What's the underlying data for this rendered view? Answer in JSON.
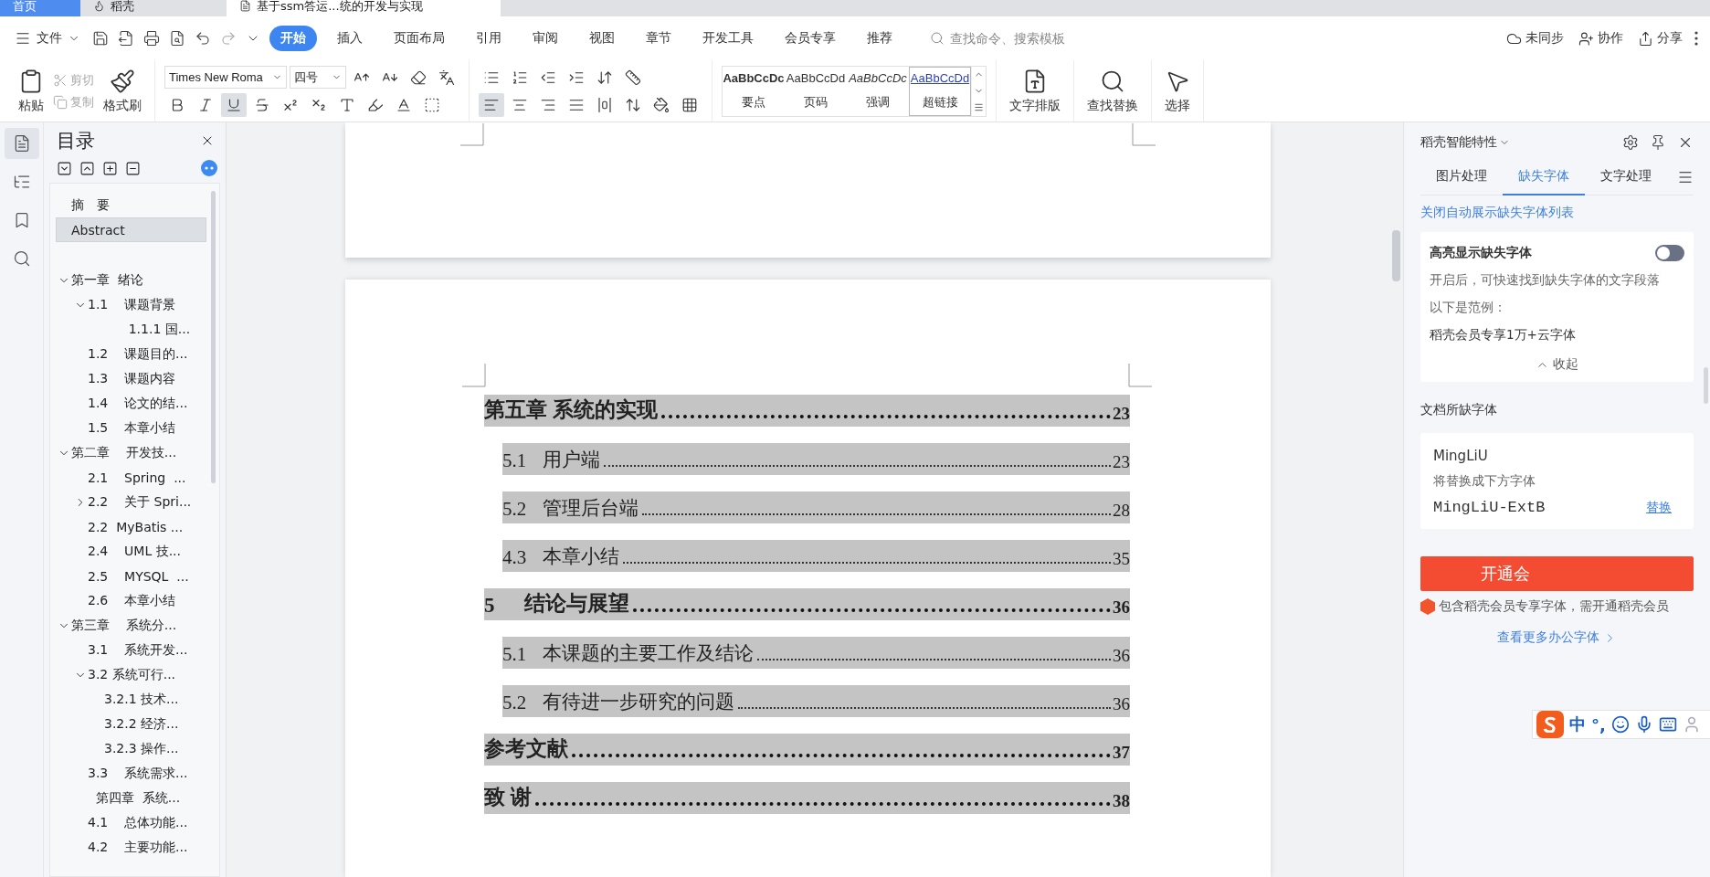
{
  "browser_tabs": [
    {
      "label": "首页",
      "kind": "home",
      "selected": false
    },
    {
      "label": "稻壳",
      "kind": "docer",
      "selected": false
    },
    {
      "label": "基于ssm答运...统的开发与实现",
      "kind": "doc",
      "selected": true
    }
  ],
  "menu": {
    "file": "文件",
    "tabs": [
      {
        "label": "开始",
        "selected": true
      },
      {
        "label": "插入",
        "selected": false
      },
      {
        "label": "页面布局",
        "selected": false
      },
      {
        "label": "引用",
        "selected": false
      },
      {
        "label": "审阅",
        "selected": false
      },
      {
        "label": "视图",
        "selected": false
      },
      {
        "label": "章节",
        "selected": false
      },
      {
        "label": "开发工具",
        "selected": false
      },
      {
        "label": "会员专享",
        "selected": false
      },
      {
        "label": "推荐",
        "selected": false
      }
    ],
    "search": {
      "placeholder": "查找命令、搜索模板"
    },
    "actions": [
      {
        "label": "未同步",
        "kind": "sync"
      },
      {
        "label": "协作",
        "kind": "collab"
      },
      {
        "label": "分享",
        "kind": "share"
      }
    ]
  },
  "ribbon": {
    "clipboard": {
      "paste": "粘贴",
      "format_painter": "格式刷",
      "cut": {
        "label": "剪切",
        "disabled": true
      },
      "copy": {
        "label": "复制",
        "disabled": true
      }
    },
    "font": {
      "name": "Times New Roma",
      "size": "四号",
      "formats": [
        {
          "kind": "bold",
          "selected": false
        },
        {
          "kind": "italic",
          "selected": false
        },
        {
          "kind": "underline",
          "selected": true
        },
        {
          "kind": "strike",
          "selected": false
        },
        {
          "kind": "superscript",
          "selected": false
        },
        {
          "kind": "subscript",
          "selected": false
        },
        {
          "kind": "effect",
          "selected": false
        },
        {
          "kind": "highlight",
          "selected": false
        },
        {
          "kind": "color",
          "selected": false
        },
        {
          "kind": "border",
          "selected": false
        }
      ]
    },
    "paragraph": {
      "aligns": [
        {
          "kind": "left",
          "selected": true
        },
        {
          "kind": "center",
          "selected": false
        },
        {
          "kind": "right",
          "selected": false
        },
        {
          "kind": "justify",
          "selected": false
        },
        {
          "kind": "distribute",
          "selected": false
        }
      ]
    },
    "styles": [
      {
        "preview": "AaBbCcDc",
        "label": "要点",
        "kind": "strong",
        "selected": false
      },
      {
        "preview": "AaBbCcDd",
        "label": "页码",
        "kind": "plain",
        "selected": false
      },
      {
        "preview": "AaBbCcDc",
        "label": "强调",
        "kind": "emphasis",
        "selected": false
      },
      {
        "preview": "AaBbCcDd",
        "label": "超链接",
        "kind": "link",
        "selected": true
      }
    ],
    "tools": [
      {
        "label": "文字排版",
        "kind": "layout"
      },
      {
        "label": "查找替换",
        "kind": "find"
      },
      {
        "label": "选择",
        "kind": "select"
      }
    ]
  },
  "rail": [
    {
      "kind": "toc",
      "selected": true
    },
    {
      "kind": "nav",
      "selected": false
    },
    {
      "kind": "bookmark",
      "selected": false
    },
    {
      "kind": "search",
      "selected": false
    }
  ],
  "toc": {
    "title": "目录",
    "front_matter": [
      {
        "label": "摘　要",
        "selected": false
      },
      {
        "label": "Abstract",
        "selected": true
      }
    ],
    "chapters": [
      {
        "label": "第一章  绪论",
        "selected": false,
        "expanded": true,
        "children": [
          {
            "label": "1.1    课题背景",
            "selected": false,
            "expanded": true,
            "children": [
              {
                "label": "      1.1.1 国...",
                "selected": false
              }
            ]
          },
          {
            "label": "1.2    课题目的...",
            "selected": false
          },
          {
            "label": "1.3    课题内容",
            "selected": false
          },
          {
            "label": "1.4    论文的结...",
            "selected": false
          },
          {
            "label": "1.5    本章小结",
            "selected": false
          }
        ]
      },
      {
        "label": "第二章    开发技...",
        "selected": false,
        "expanded": true,
        "children": [
          {
            "label": "2.1    Spring  ...",
            "selected": false
          },
          {
            "label": "2.2    关于 Spri...",
            "selected": false,
            "expanded": false
          },
          {
            "label": "2.2  MyBatis ...",
            "selected": false
          },
          {
            "label": "2.4    UML 技...",
            "selected": false
          },
          {
            "label": "2.5    MYSQL  ...",
            "selected": false
          },
          {
            "label": "2.6    本章小结",
            "selected": false
          }
        ]
      },
      {
        "label": "第三章    系统分...",
        "selected": false,
        "expanded": true,
        "children": [
          {
            "label": "3.1    系统开发...",
            "selected": false
          },
          {
            "label": "3.2 系统可行...",
            "selected": false,
            "expanded": true,
            "children": [
              {
                "label": "3.2.1 技术...",
                "selected": false
              },
              {
                "label": "3.2.2 经济...",
                "selected": false
              },
              {
                "label": "3.2.3 操作...",
                "selected": false
              }
            ]
          },
          {
            "label": "3.3    系统需求...",
            "selected": false
          },
          {
            "label": "  第四章  系统...",
            "selected": false
          },
          {
            "label": "4.1    总体功能...",
            "selected": false
          },
          {
            "label": "4.2    主要功能...",
            "selected": false
          }
        ]
      }
    ]
  },
  "document": {
    "entries": [
      {
        "kind": "chapter",
        "title": "第五章  系统的实现",
        "page": "23"
      },
      {
        "kind": "section",
        "number": "5.1",
        "title": "用户端",
        "page": "23"
      },
      {
        "kind": "section",
        "number": "5.2",
        "title": "管理后台端",
        "page": "28"
      },
      {
        "kind": "section",
        "number": "4.3",
        "title": "本章小结",
        "page": "35"
      },
      {
        "kind": "chapter",
        "number": "5",
        "title": "结论与展望",
        "page": "36"
      },
      {
        "kind": "section",
        "number": "5.1",
        "title": "本课题的主要工作及结论",
        "page": "36"
      },
      {
        "kind": "section",
        "number": "5.2",
        "title": "有待进一步研究的问题",
        "page": "36"
      },
      {
        "kind": "chapter",
        "title": "参考文献",
        "page": "37"
      },
      {
        "kind": "chapter",
        "title": "致  谢",
        "page": "38"
      }
    ]
  },
  "panel": {
    "title": "稻壳智能特性",
    "tabs": [
      {
        "label": "图片处理",
        "selected": false
      },
      {
        "label": "缺失字体",
        "selected": true
      },
      {
        "label": "文字处理",
        "selected": false
      }
    ],
    "close_list_link": "关闭自动展示缺失字体列表",
    "highlight": {
      "title": "高亮显示缺失字体",
      "on": false,
      "description": "开启后，可快速找到缺失字体的文字段落",
      "example_label": "以下是范例：",
      "example": "稻壳会员专享1万+云字体",
      "collapse": "收起"
    },
    "missing_title": "文档所缺字体",
    "missing_fonts": [
      {
        "name": "MingLiU",
        "hint": "将替换成下方字体",
        "replacement": "MingLiU-ExtB",
        "action": "替换"
      }
    ],
    "button": "开通会",
    "note": "包含稻壳会员专享字体，需开通稻壳会员",
    "more_link": "查看更多办公字体"
  },
  "ime": {
    "mode": "中",
    "punct": "°,"
  }
}
